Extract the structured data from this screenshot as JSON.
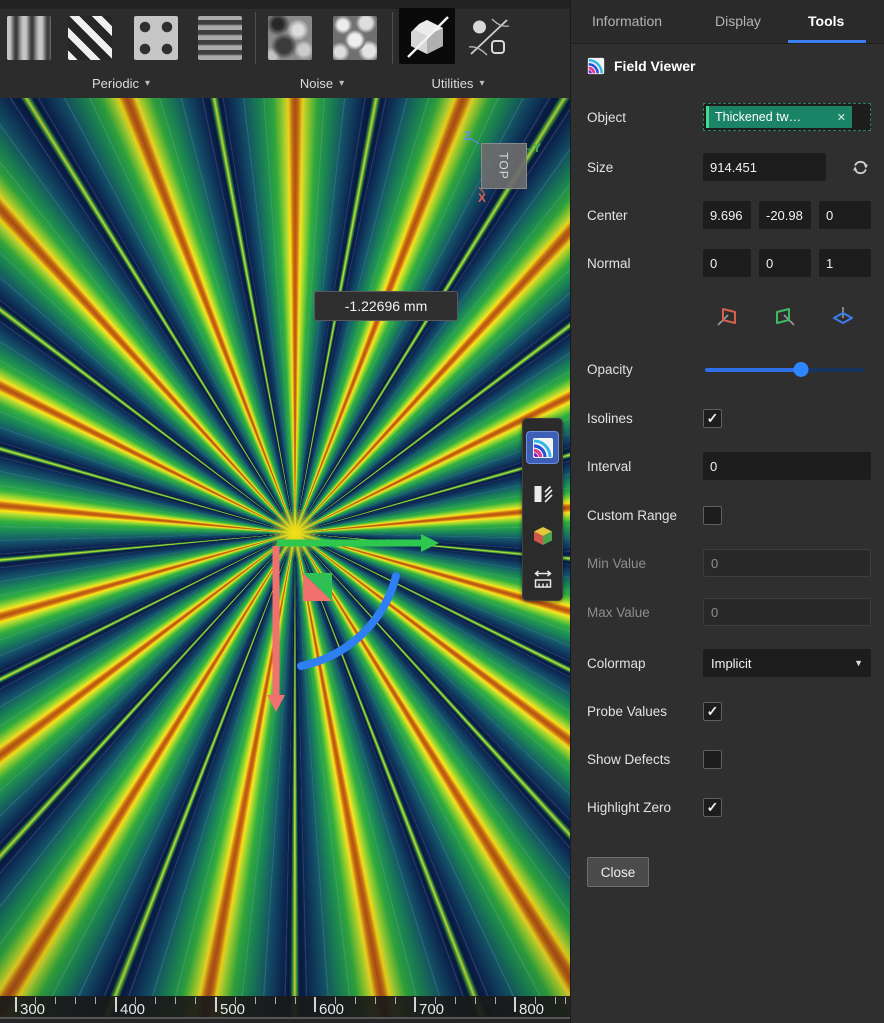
{
  "glyphs": {
    "check": "✓",
    "caret_down": "▼",
    "caret_small": "▾",
    "close": "✕"
  },
  "toolbar": {
    "groups": [
      {
        "label": "Periodic",
        "icons": [
          "wavy-stripes",
          "diagonal-stripes",
          "dot-grid",
          "gyroid-lattice"
        ]
      },
      {
        "label": "Noise",
        "icons": [
          "perlin-noise",
          "voronoi-cells"
        ]
      },
      {
        "label": "Utilities",
        "icons": [
          "implicit-body",
          "field-utilities"
        ]
      }
    ]
  },
  "panel": {
    "tabs": [
      {
        "label": "Information",
        "active": false
      },
      {
        "label": "Display",
        "active": false
      },
      {
        "label": "Tools",
        "active": true
      }
    ],
    "title": "Field Viewer",
    "object": {
      "label": "Object",
      "value": "Thickened tw…"
    },
    "size": {
      "label": "Size",
      "value": "914.451"
    },
    "center": {
      "label": "Center",
      "x": "9.696",
      "y": "-20.98",
      "z": "0"
    },
    "normal": {
      "label": "Normal",
      "x": "0",
      "y": "0",
      "z": "1"
    },
    "plane_buttons": [
      "yz-plane-red",
      "xz-plane-green",
      "xy-plane-blue"
    ],
    "opacity": {
      "label": "Opacity",
      "percent": 60
    },
    "isolines": {
      "label": "Isolines",
      "checked": true
    },
    "interval": {
      "label": "Interval",
      "value": "0"
    },
    "custom_range": {
      "label": "Custom Range",
      "checked": false
    },
    "min_value": {
      "label": "Min Value",
      "value": "0",
      "disabled": true
    },
    "max_value": {
      "label": "Max Value",
      "value": "0",
      "disabled": true
    },
    "colormap": {
      "label": "Colormap",
      "value": "Implicit"
    },
    "probe_values": {
      "label": "Probe Values",
      "checked": true
    },
    "show_defects": {
      "label": "Show Defects",
      "checked": false
    },
    "highlight_zero": {
      "label": "Highlight Zero",
      "checked": true
    },
    "close_label": "Close"
  },
  "viewport": {
    "probe_value": "-1.22696 mm",
    "view_cube": {
      "face": "TOP",
      "axes": {
        "x": "X",
        "y": "Y",
        "z": "Z"
      }
    },
    "side_toolbar": [
      "field-viewer",
      "section-view",
      "shaded-view",
      "measure"
    ],
    "ruler": {
      "labels": [
        "300",
        "400",
        "500",
        "600",
        "700",
        "800"
      ]
    },
    "colors": {
      "ray_core": "#b5530f",
      "ray_yellow": "#ffe515",
      "ray_green": "#2aa648",
      "background_navy": "#0a1c44",
      "accent_blue": "#2e7ff2",
      "gizmo_green": "#2ec84e",
      "gizmo_red": "#f0716d"
    }
  }
}
